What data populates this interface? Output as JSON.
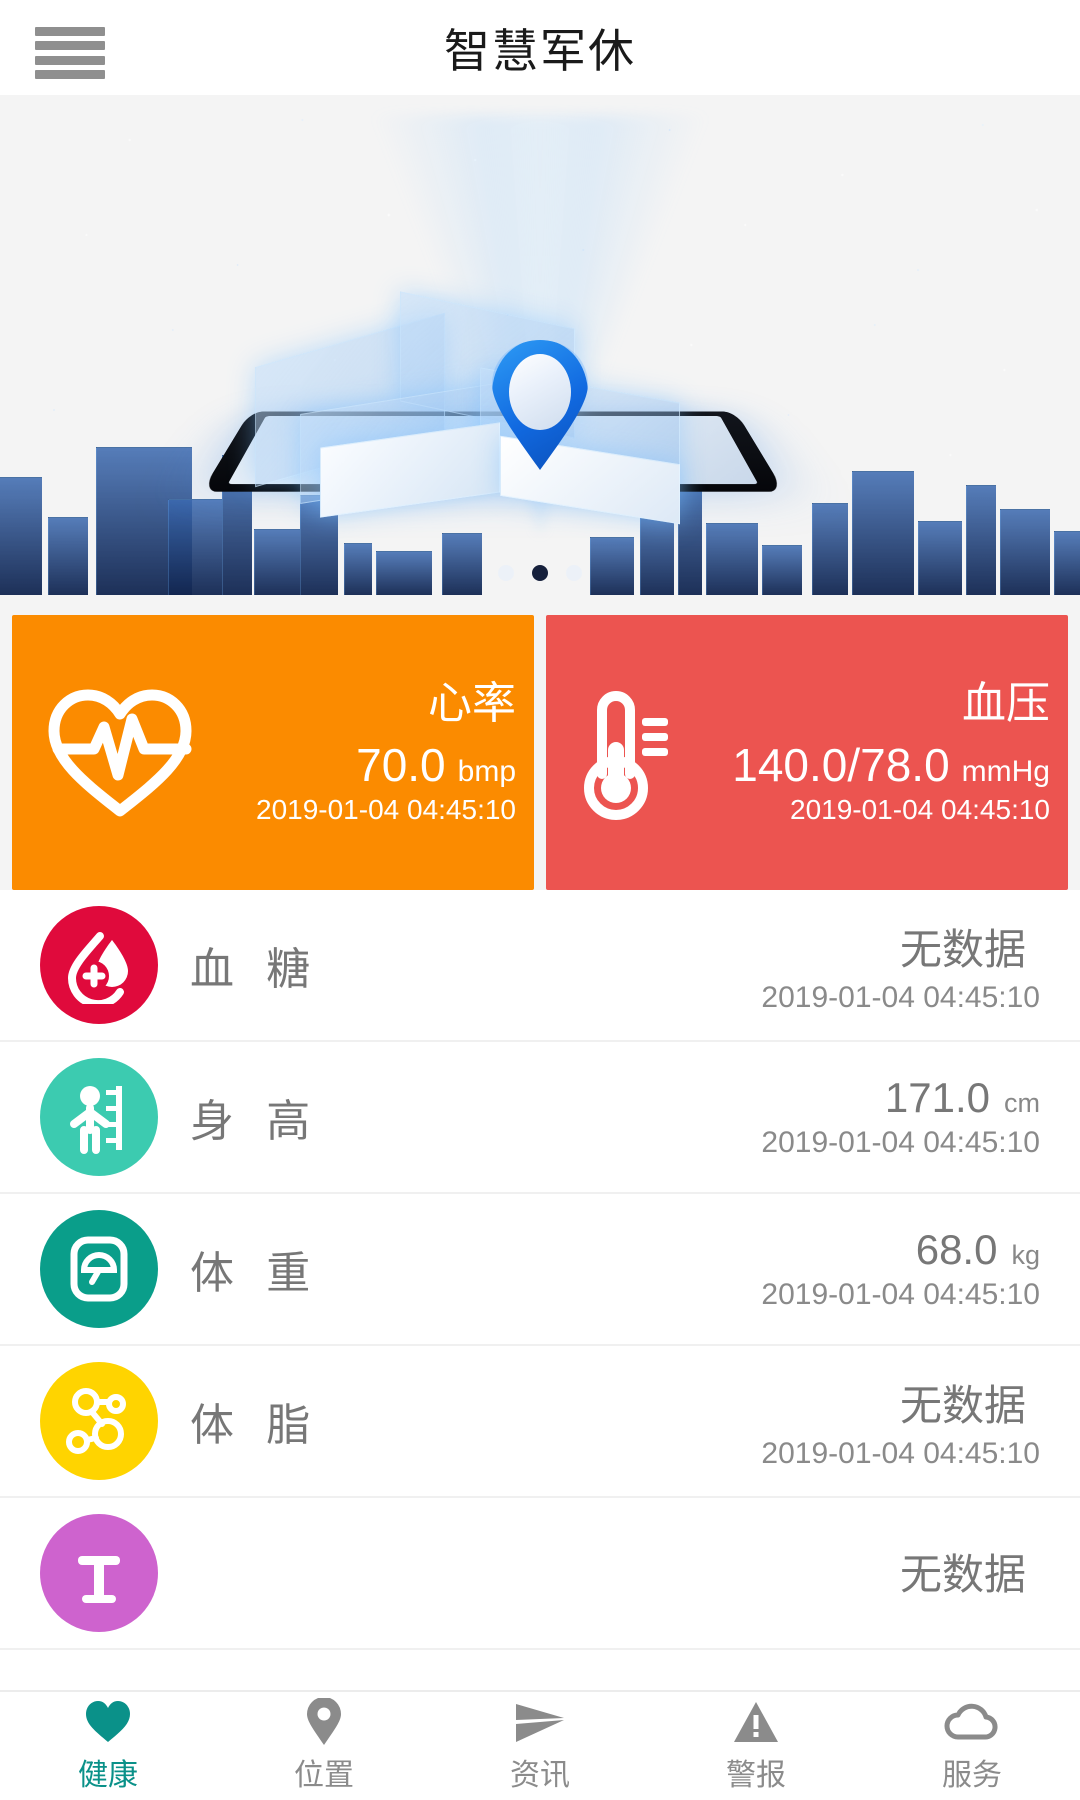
{
  "header": {
    "title": "智慧军休",
    "menu_icon": "hamburger-menu-icon"
  },
  "banner": {
    "icon": "location-pin-icon",
    "carousel_dots": 3,
    "active_dot_index": 1
  },
  "metric_cards": [
    {
      "id": "heart-rate",
      "title": "心率",
      "value": "70.0",
      "unit": "bmp",
      "timestamp": "2019-01-04 04:45:10",
      "color": "#fb8b00",
      "icon": "heartbeat-icon"
    },
    {
      "id": "blood-pressure",
      "title": "血压",
      "value": "140.0/78.0",
      "unit": "mmHg",
      "timestamp": "2019-01-04 04:45:10",
      "color": "#ec5450",
      "icon": "thermometer-icon"
    }
  ],
  "health_rows": [
    {
      "id": "blood-sugar",
      "label": "血 糖",
      "value": "无数据",
      "unit": "",
      "timestamp": "2019-01-04 04:45:10",
      "color": "#e00a3c",
      "icon": "blood-drop-icon"
    },
    {
      "id": "height",
      "label": "身 高",
      "value": "171.0",
      "unit": "cm",
      "timestamp": "2019-01-04 04:45:10",
      "color": "#3ccbb0",
      "icon": "height-ruler-icon"
    },
    {
      "id": "weight",
      "label": "体 重",
      "value": "68.0",
      "unit": "kg",
      "timestamp": "2019-01-04 04:45:10",
      "color": "#0a9e8a",
      "icon": "weight-scale-icon"
    },
    {
      "id": "body-fat",
      "label": "体 脂",
      "value": "无数据",
      "unit": "",
      "timestamp": "2019-01-04 04:45:10",
      "color": "#ffd400",
      "icon": "molecule-icon"
    },
    {
      "id": "partial-row",
      "label": "",
      "value": "无数据",
      "unit": "",
      "timestamp": "",
      "color": "#ce63ce",
      "icon": "device-icon"
    }
  ],
  "bottom_nav": [
    {
      "id": "health",
      "label": "健康",
      "icon": "heart-icon",
      "active": true
    },
    {
      "id": "location",
      "label": "位置",
      "icon": "map-pin-icon",
      "active": false
    },
    {
      "id": "news",
      "label": "资讯",
      "icon": "send-arrow-icon",
      "active": false
    },
    {
      "id": "alarm",
      "label": "警报",
      "icon": "warning-triangle-icon",
      "active": false
    },
    {
      "id": "service",
      "label": "服务",
      "icon": "cloud-icon",
      "active": false
    }
  ],
  "theme": {
    "accent": "#0a9189",
    "page_bg": "#f4f4f4",
    "text_gray": "#777777"
  }
}
